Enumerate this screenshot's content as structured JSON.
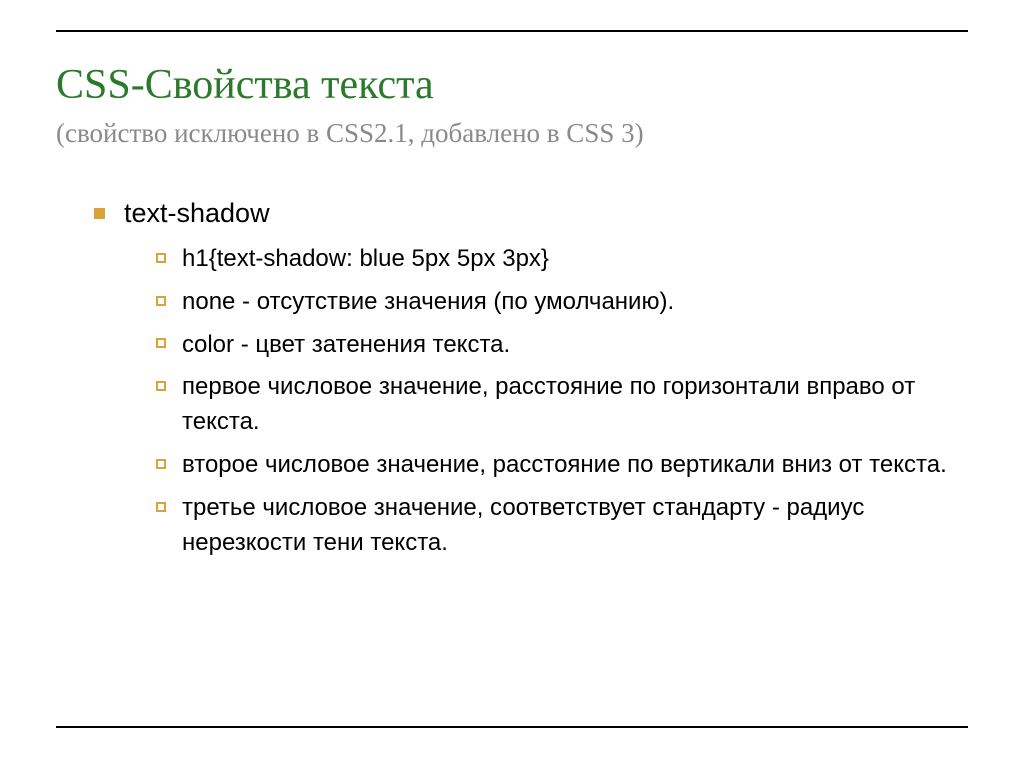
{
  "title": "CSS-Свойства текста",
  "subtitle": "(свойство исключено в CSS2.1, добавлено в CSS 3)",
  "items": [
    {
      "text": "text-shadow",
      "children": [
        "h1{text-shadow: blue 5px 5px 3px}",
        "none - отсутствие значения (по умолчанию).",
        "color - цвет затенения текста.",
        "первое числовое значение, расстояние по горизонтали вправо от текста.",
        "второе числовое значение, расстояние по вертикали вниз от текста.",
        "третье числовое значение, соответствует стандарту - радиус нерезкости тени текста."
      ]
    }
  ]
}
